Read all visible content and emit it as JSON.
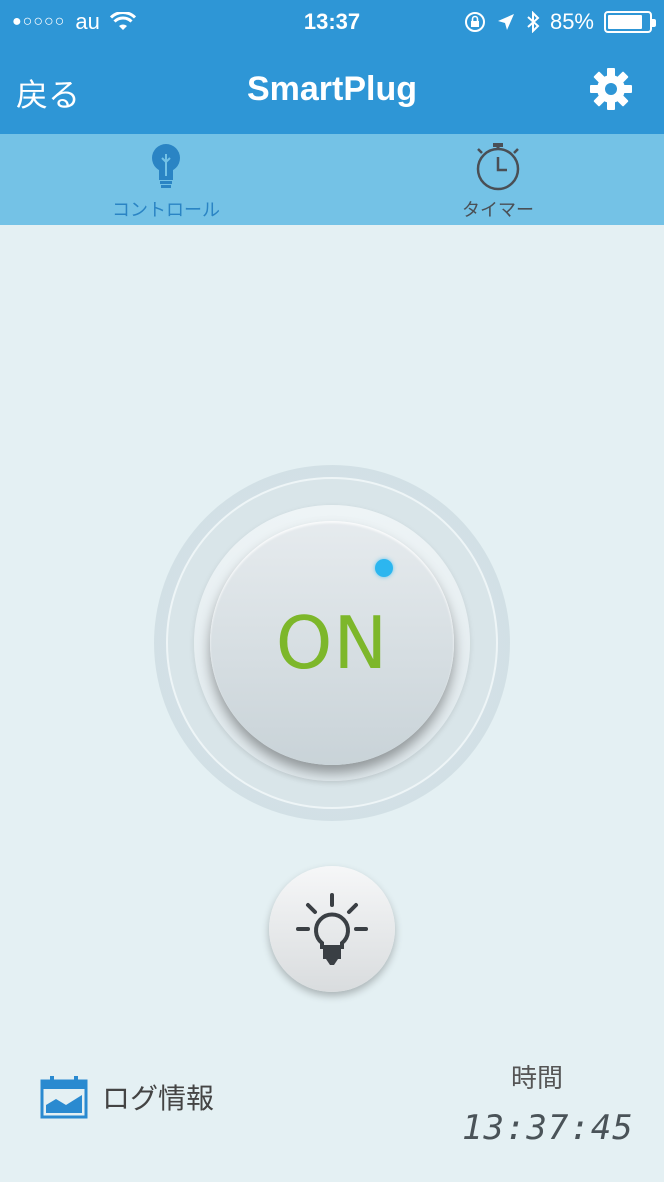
{
  "status": {
    "carrier": "au",
    "signal_dots": "●○○○○",
    "time": "13:37",
    "battery_percent": "85%",
    "battery_level": 0.85
  },
  "nav": {
    "back_label": "戻る",
    "title": "SmartPlug",
    "settings_icon": "gear-icon"
  },
  "tabs": [
    {
      "label": "コントロール",
      "icon": "lightbulb-icon",
      "active": true
    },
    {
      "label": "タイマー",
      "icon": "stopwatch-icon",
      "active": false
    }
  ],
  "power": {
    "label": "ON",
    "label_color": "#7db72a",
    "led_color": "#2cb6ef"
  },
  "light_button": {
    "icon": "lightbulb-icon"
  },
  "footer": {
    "log_label": "ログ情報",
    "log_icon": "chart-calendar-icon",
    "time_label": "時間",
    "clock": "13:37:45"
  },
  "colors": {
    "header": "#2e96d6",
    "tabbar": "#74c2e6",
    "background": "#e4f0f3"
  }
}
